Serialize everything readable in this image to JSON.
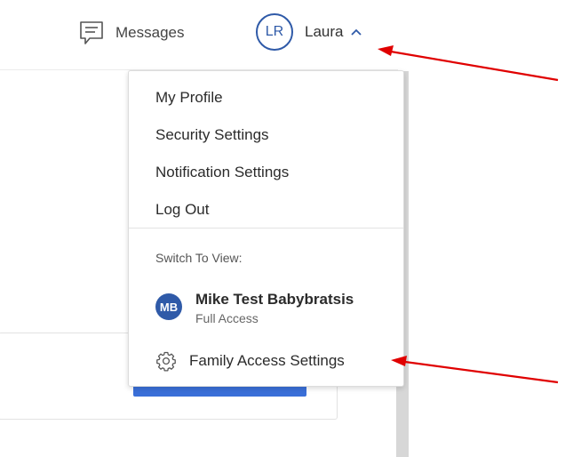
{
  "header": {
    "messages_label": "Messages",
    "user_initials": "LR",
    "user_name": "Laura"
  },
  "dropdown": {
    "items": [
      {
        "label": "My Profile"
      },
      {
        "label": "Security Settings"
      },
      {
        "label": "Notification Settings"
      },
      {
        "label": "Log Out"
      }
    ],
    "switch_label": "Switch To View:",
    "account": {
      "initials": "MB",
      "name": "Mike Test Babybratsis",
      "access": "Full Access"
    },
    "family_settings_label": "Family Access Settings"
  },
  "colors": {
    "brand_blue": "#2f5aa8",
    "button_blue": "#3a6fd8",
    "annotation_red": "#e00000"
  }
}
